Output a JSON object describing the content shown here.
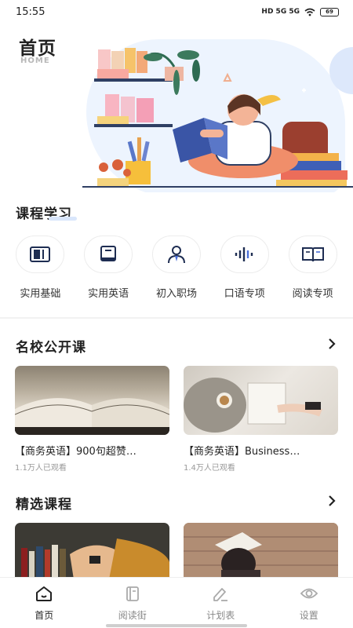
{
  "status": {
    "time": "15:55",
    "network": "HD 5G 5G",
    "battery": "69"
  },
  "header": {
    "title": "首页",
    "subtitle": "HOME"
  },
  "course_section": {
    "title": "课程学习",
    "categories": [
      {
        "label": "实用基础",
        "icon": "book-columns-icon"
      },
      {
        "label": "实用英语",
        "icon": "book-icon"
      },
      {
        "label": "初入职场",
        "icon": "person-tie-icon"
      },
      {
        "label": "口语专项",
        "icon": "audio-wave-icon"
      },
      {
        "label": "阅读专项",
        "icon": "open-book-icon"
      }
    ]
  },
  "open_courses": {
    "title": "名校公开课",
    "items": [
      {
        "title": "【商务英语】900句超赞…",
        "views": "1.1万人已观看",
        "image": "open-book-photo"
      },
      {
        "title": "【商务英语】Business…",
        "views": "1.4万人已观看",
        "image": "reading-in-bed-photo"
      }
    ]
  },
  "featured": {
    "title": "精选课程",
    "items": [
      {
        "image": "bookshelf-photo"
      },
      {
        "image": "book-on-head-photo"
      }
    ]
  },
  "nav": {
    "items": [
      {
        "label": "首页",
        "icon": "home-icon",
        "active": true
      },
      {
        "label": "阅读街",
        "icon": "reading-icon",
        "active": false
      },
      {
        "label": "计划表",
        "icon": "edit-icon",
        "active": false
      },
      {
        "label": "设置",
        "icon": "settings-icon",
        "active": false
      }
    ]
  },
  "colors": {
    "accent": "#2a4ea8",
    "hero_bg": "#edf4fe",
    "muted": "#999999"
  }
}
